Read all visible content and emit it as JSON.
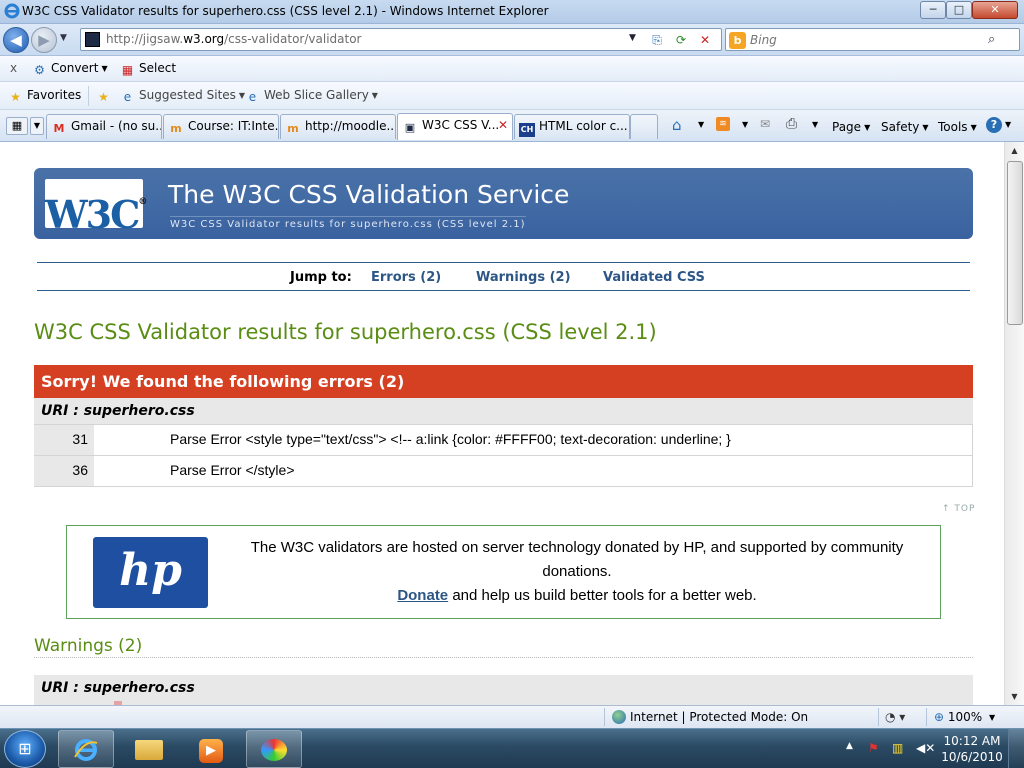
{
  "window": {
    "title": "W3C CSS Validator results for superhero.css (CSS level 2.1) - Windows Internet Explorer",
    "min": "─",
    "max": "□",
    "close": "✕"
  },
  "nav": {
    "url_prefix": "http://jigsaw.",
    "url_domain": "w3.org",
    "url_path": "/css-validator/validator",
    "search_placeholder": "Bing"
  },
  "command_bar": {
    "close": "x",
    "convert": "Convert",
    "select": "Select"
  },
  "favorites_bar": {
    "favorites": "Favorites",
    "suggested": "Suggested Sites",
    "webslice": "Web Slice Gallery"
  },
  "tabs": [
    {
      "icon": "M",
      "label": "Gmail - (no su...",
      "color": "#d93025"
    },
    {
      "icon": "m",
      "label": "Course: IT:Inte...",
      "color": "#e38b1b"
    },
    {
      "icon": "m",
      "label": "http://moodle....",
      "color": "#e38b1b"
    },
    {
      "icon": "▣",
      "label": "W3C CSS V...",
      "color": "#1c2a44"
    },
    {
      "icon": "CH",
      "label": "HTML color c...",
      "color": "#1b3f8a"
    }
  ],
  "right_tools": {
    "page": "Page",
    "safety": "Safety",
    "tools": "Tools",
    "help": "?"
  },
  "page": {
    "banner_title": "The W3C CSS Validation Service",
    "banner_sub": "W3C CSS Validator results for superhero.css (CSS level 2.1)",
    "logo_text": "W3C",
    "logo_mark": "®",
    "jump_label": "Jump to:",
    "jump_links": [
      "Errors (2)",
      "Warnings (2)",
      "Validated CSS"
    ],
    "results_title": "W3C CSS Validator results for superhero.css (CSS level 2.1)",
    "errors_heading": "Sorry! We found the following errors (2)",
    "uri_label": "URI : superhero.css",
    "errors": [
      {
        "line": "31",
        "message": "Parse Error <style type=\"text/css\"> <!-- a:link {color: #FFFF00; text-decoration: underline; }"
      },
      {
        "line": "36",
        "message": "Parse Error </style>"
      }
    ],
    "top_link": "↑ TOP",
    "hp_logo": "hp",
    "hp_text": "The W3C validators are hosted on server technology donated by HP, and supported by community donations.",
    "donate": "Donate",
    "donate_rest": " and help us build better tools for a better web.",
    "warnings_title": "Warnings (2)",
    "warnings_uri": "URI : superhero.css"
  },
  "status": {
    "zone": "Internet | Protected Mode: On",
    "zoom": "100%"
  },
  "taskbar": {
    "time": "10:12 AM",
    "date": "10/6/2010"
  },
  "colors": {
    "banner": "#3f67a3",
    "error_red": "#d53f22",
    "result_green": "#5a8d13",
    "link_blue": "#2c5685"
  }
}
